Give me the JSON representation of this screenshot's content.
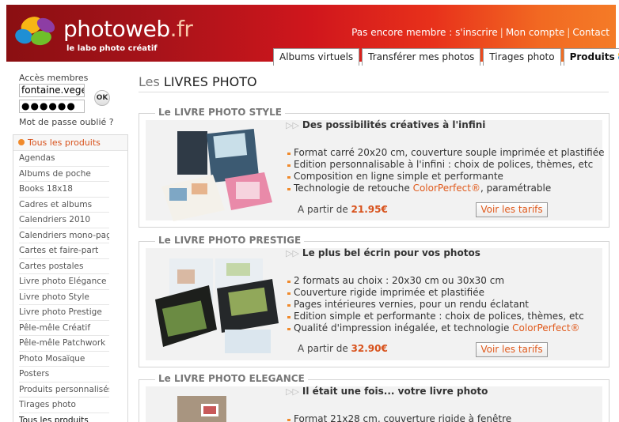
{
  "header": {
    "logo_text": "photoweb",
    "logo_tld": ".fr",
    "tagline": "le labo photo créatif",
    "top_links": [
      "Pas encore membre : s'inscrire",
      "Mon compte",
      "Contact"
    ],
    "tabs": [
      {
        "label": "Albums virtuels",
        "active": false
      },
      {
        "label": "Transférer mes photos",
        "active": false
      },
      {
        "label": "Tirages photo",
        "active": false
      },
      {
        "label": "Produits",
        "active": true
      }
    ]
  },
  "login": {
    "label": "Accès membres",
    "username_value": "fontaine.vege",
    "password_mask": "●●●●●●",
    "ok_label": "OK",
    "forgot_label": "Mot de passe oublié ?"
  },
  "products": {
    "header": "Tous les produits",
    "items": [
      "Agendas",
      "Albums de poche",
      "Books 18x18",
      "Cadres et albums",
      "Calendriers 2010",
      "Calendriers mono-page",
      "Cartes et faire-part",
      "Cartes postales",
      "Livre photo Elégance",
      "Livre photo Style",
      "Livre photo Prestige",
      "Pêle-mêle Créatif",
      "Pêle-mêle Patchwork",
      "Photo Mosaïque",
      "Posters",
      "Produits personnalisés",
      "Tirages photo",
      "Tous les produits"
    ]
  },
  "main": {
    "title_prefix": "Les ",
    "title_main": "LIVRES PHOTO",
    "cards": [
      {
        "title": "Le LIVRE PHOTO STYLE",
        "headline": "Des possibilités créatives à l'infini",
        "bullets": [
          "Format carré 20x20 cm, couverture souple imprimée et plastifiée",
          "Edition personnalisable à l'infini : choix de polices, thèmes, etc",
          "Composition en ligne simple et performante",
          "Technologie de retouche |ColorPerfect®|, paramétrable"
        ],
        "b1": "Format carré 20x20 cm, couverture souple imprimée et plastifiée",
        "b2": "Edition personnalisable à l'infini : choix de polices, thèmes, etc",
        "b3": "Composition en ligne simple et performante",
        "b4_pre": "Technologie de retouche ",
        "b4_accent": "ColorPerfect®",
        "b4_post": ", paramétrable",
        "price_label": "A partir de ",
        "price": "21.95€",
        "button": "Voir les tarifs"
      },
      {
        "title": "Le LIVRE PHOTO PRESTIGE",
        "headline": "Le plus bel écrin pour vos photos",
        "b1": "2 formats au choix : 20x30 cm ou 30x30 cm",
        "b2": "Couverture rigide imprimée et plastifiée",
        "b3": "Pages intérieures vernies, pour un rendu éclatant",
        "b4": "Edition simple et performante : choix de polices, thèmes, etc",
        "b5_pre": "Qualité d'impression inégalée, et technologie ",
        "b5_accent": "ColorPerfect®",
        "price_label": "A partir de ",
        "price": "32.90€",
        "button": "Voir les tarifs"
      },
      {
        "title": "Le LIVRE PHOTO ELEGANCE",
        "headline": "Il était une fois... votre livre photo",
        "b1": "Format 21x28 cm, couverture rigide à fenêtre"
      }
    ]
  },
  "colors": {
    "accent": "#e05a1c",
    "header_start": "#8a0f12",
    "header_end": "#f47b27"
  }
}
